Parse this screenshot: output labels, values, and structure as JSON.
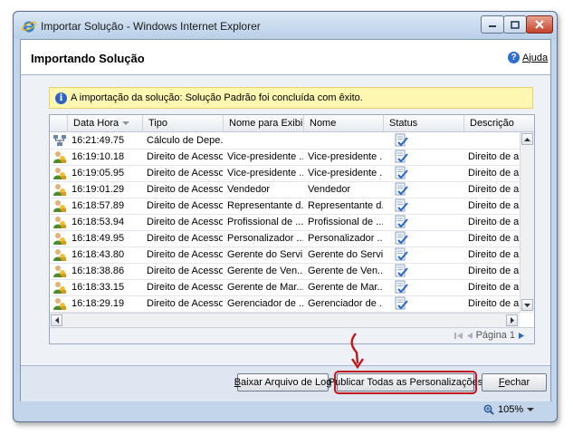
{
  "window": {
    "title": "Importar Solução - Windows Internet Explorer"
  },
  "header": {
    "title": "Importando Solução",
    "help_label": "Ajuda"
  },
  "info_bar": {
    "message": "A importação da solução: Solução Padrão foi concluída com êxito."
  },
  "grid": {
    "columns": [
      "Data Hora",
      "Tipo",
      "Nome para Exibi...",
      "Nome",
      "Status",
      "Descrição"
    ],
    "rows": [
      {
        "icon": "process-icon",
        "time": "16:21:49.75",
        "type": "Cálculo de Depe...",
        "display": "",
        "name": "",
        "status": "status-ok-icon",
        "desc": ""
      },
      {
        "icon": "user-role-icon",
        "time": "16:19:10.18",
        "type": "Direito de Acesso",
        "display": "Vice-presidente ...",
        "name": "Vice-presidente ...",
        "status": "status-ok-icon",
        "desc": "Direito de a"
      },
      {
        "icon": "user-role-icon",
        "time": "16:19:05.95",
        "type": "Direito de Acesso",
        "display": "Vice-presidente ...",
        "name": "Vice-presidente ...",
        "status": "status-ok-icon",
        "desc": "Direito de a"
      },
      {
        "icon": "user-role-icon",
        "time": "16:19:01.29",
        "type": "Direito de Acesso",
        "display": "Vendedor",
        "name": "Vendedor",
        "status": "status-ok-icon",
        "desc": "Direito de a"
      },
      {
        "icon": "user-role-icon",
        "time": "16:18:57.89",
        "type": "Direito de Acesso",
        "display": "Representante d...",
        "name": "Representante d...",
        "status": "status-ok-icon",
        "desc": "Direito de a"
      },
      {
        "icon": "user-role-icon",
        "time": "16:18:53.94",
        "type": "Direito de Acesso",
        "display": "Profissional de ...",
        "name": "Profissional de ...",
        "status": "status-ok-icon",
        "desc": "Direito de a"
      },
      {
        "icon": "user-role-icon",
        "time": "16:18:49.95",
        "type": "Direito de Acesso",
        "display": "Personalizador ...",
        "name": "Personalizador ...",
        "status": "status-ok-icon",
        "desc": "Direito de a"
      },
      {
        "icon": "user-role-icon",
        "time": "16:18:43.80",
        "type": "Direito de Acesso",
        "display": "Gerente do Servi...",
        "name": "Gerente do Servi...",
        "status": "status-ok-icon",
        "desc": "Direito de a"
      },
      {
        "icon": "user-role-icon",
        "time": "16:18:38.86",
        "type": "Direito de Acesso",
        "display": "Gerente de Ven...",
        "name": "Gerente de Ven...",
        "status": "status-ok-icon",
        "desc": "Direito de a"
      },
      {
        "icon": "user-role-icon",
        "time": "16:18:33.15",
        "type": "Direito de Acesso",
        "display": "Gerente de Mar...",
        "name": "Gerente de Mar...",
        "status": "status-ok-icon",
        "desc": "Direito de a"
      },
      {
        "icon": "user-role-icon",
        "time": "16:18:29.19",
        "type": "Direito de Acesso",
        "display": "Gerenciador de ...",
        "name": "Gerenciador de ...",
        "status": "status-ok-icon",
        "desc": "Direito de a"
      }
    ],
    "pager": "Página 1"
  },
  "footer": {
    "download_log": "Baixar Arquivo de Log",
    "download_log_accel": "B",
    "download_log_rest": "aixar Arquivo de Log",
    "publish_all": "Publicar Todas as Personalizações",
    "close": "Fechar",
    "close_accel": "F",
    "close_rest": "echar"
  },
  "status_bar": {
    "zoom": "105%"
  },
  "colors": {
    "highlight": "#c0161c",
    "info_bg": "#fdf7b1"
  }
}
